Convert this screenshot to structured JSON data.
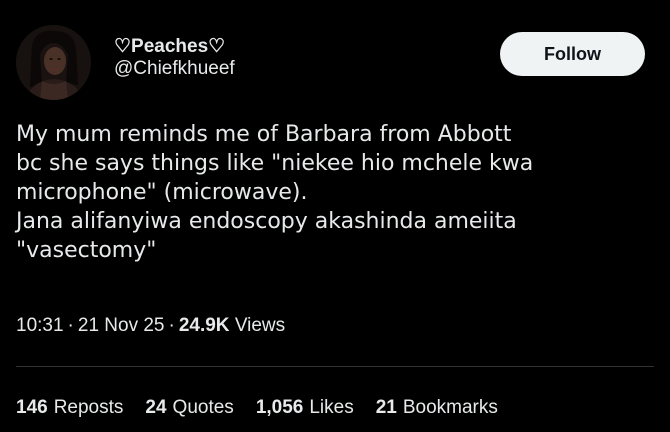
{
  "author": {
    "display_name": "♡Peaches♡",
    "handle": "@Chiefkhueef"
  },
  "follow_button": {
    "label": "Follow"
  },
  "tweet": {
    "lines": [
      "My mum reminds me of Barbara from Abbott",
      "bc she says things like \"niekee hio mchele kwa",
      "microphone\" (microwave).",
      "Jana alifanyiwa endoscopy akashinda ameiita",
      "\"vasectomy\""
    ]
  },
  "meta": {
    "time": "10:31",
    "date": "21 Nov 25",
    "views_count": "24.9K",
    "views_label": "Views",
    "separator": "·"
  },
  "stats": {
    "reposts": {
      "count": "146",
      "label": "Reposts"
    },
    "quotes": {
      "count": "24",
      "label": "Quotes"
    },
    "likes": {
      "count": "1,056",
      "label": "Likes"
    },
    "bookmarks": {
      "count": "21",
      "label": "Bookmarks"
    }
  },
  "colors": {
    "background": "#000000",
    "text": "#e7e9ea",
    "follow_bg": "#eff3f4",
    "follow_text": "#0f1419",
    "divider": "#2f3336"
  }
}
